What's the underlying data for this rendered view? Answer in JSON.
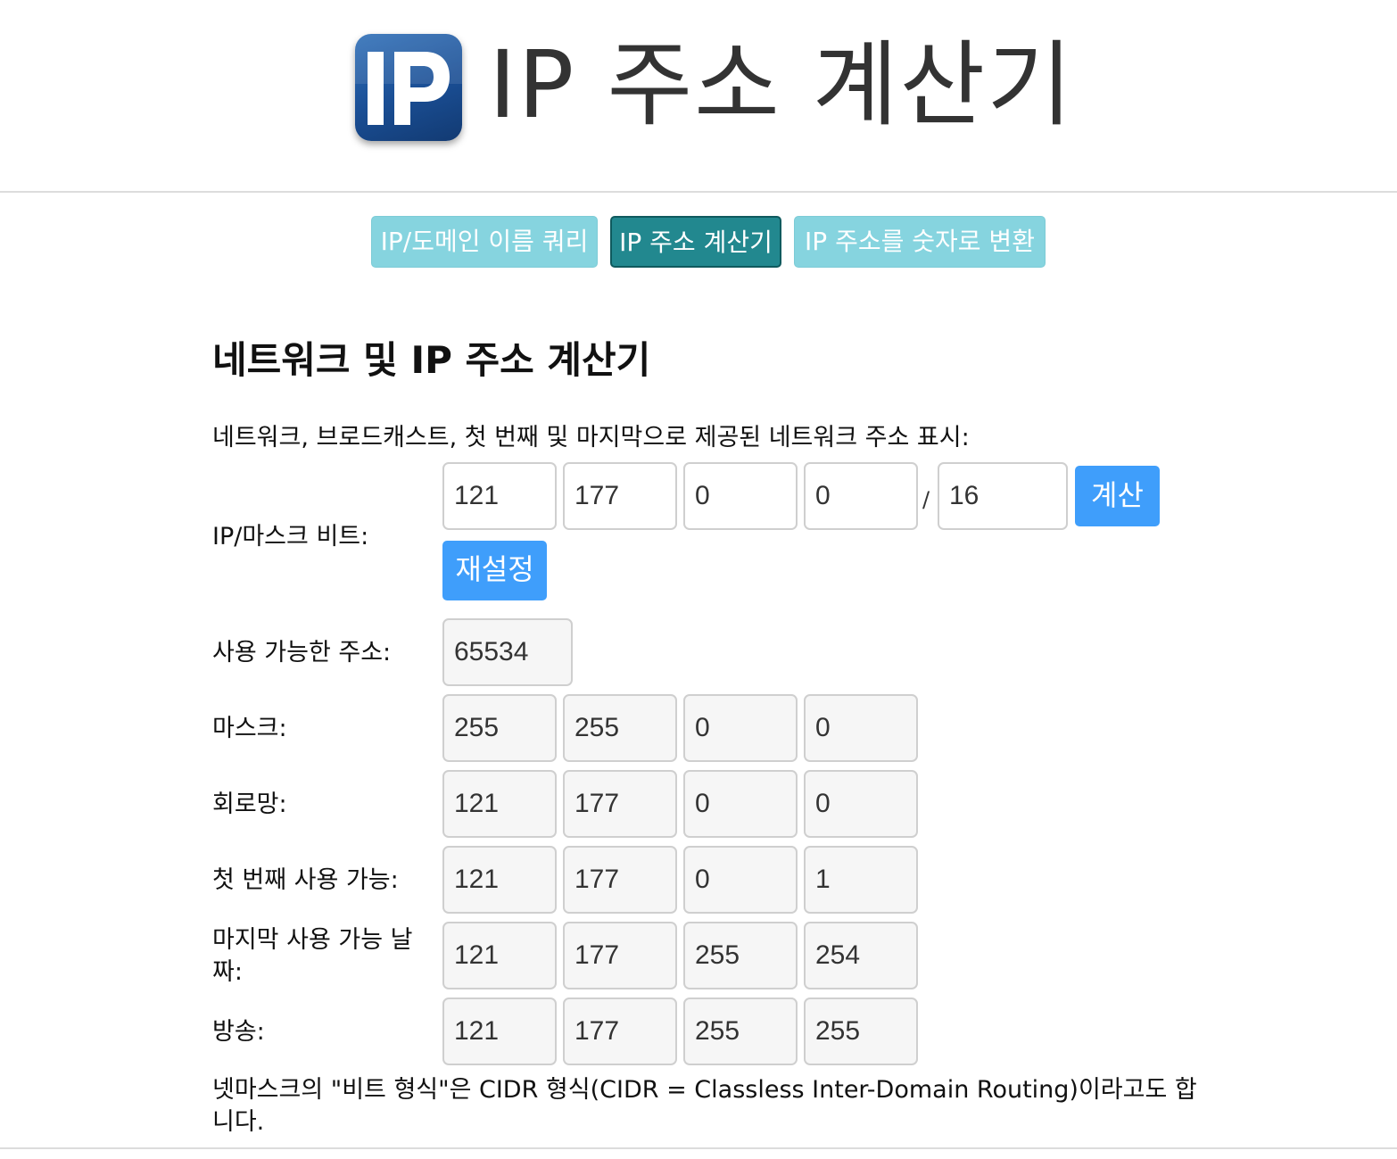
{
  "header": {
    "logo_text": "IP",
    "title": "IP 주소 계산기"
  },
  "nav": {
    "items": [
      {
        "label": "IP/도메인 이름 쿼리",
        "active": false
      },
      {
        "label": "IP 주소 계산기",
        "active": true
      },
      {
        "label": "IP 주소를 숫자로 변환",
        "active": false
      }
    ]
  },
  "main": {
    "heading": "네트워크 및 IP 주소 계산기",
    "description": "네트워크, 브로드캐스트, 첫 번째 및 마지막으로 제공된 네트워크 주소 표시:",
    "ip_mask": {
      "label": "IP/마스크 비트:",
      "octets": [
        "121",
        "177",
        "0",
        "0"
      ],
      "separator": "/",
      "mask_bits": "16",
      "calculate_label": "계산",
      "reset_label": "재설정"
    },
    "usable_addresses": {
      "label": "사용 가능한 주소:",
      "value": "65534"
    },
    "results": [
      {
        "label": "마스크:",
        "values": [
          "255",
          "255",
          "0",
          "0"
        ]
      },
      {
        "label": "회로망:",
        "values": [
          "121",
          "177",
          "0",
          "0"
        ]
      },
      {
        "label": "첫 번째 사용 가능:",
        "values": [
          "121",
          "177",
          "0",
          "1"
        ]
      },
      {
        "label": "마지막 사용 가능 날짜:",
        "values": [
          "121",
          "177",
          "255",
          "254"
        ]
      },
      {
        "label": "방송:",
        "values": [
          "121",
          "177",
          "255",
          "255"
        ]
      }
    ],
    "footer_note": "넷마스크의 \"비트 형식\"은 CIDR 형식(CIDR = Classless Inter-Domain Routing)이라고도 합니다."
  },
  "colors": {
    "nav_light": "#86d4df",
    "nav_active": "#22888f",
    "primary_button": "#3f9efb",
    "logo_blue": "#1a4e94"
  }
}
